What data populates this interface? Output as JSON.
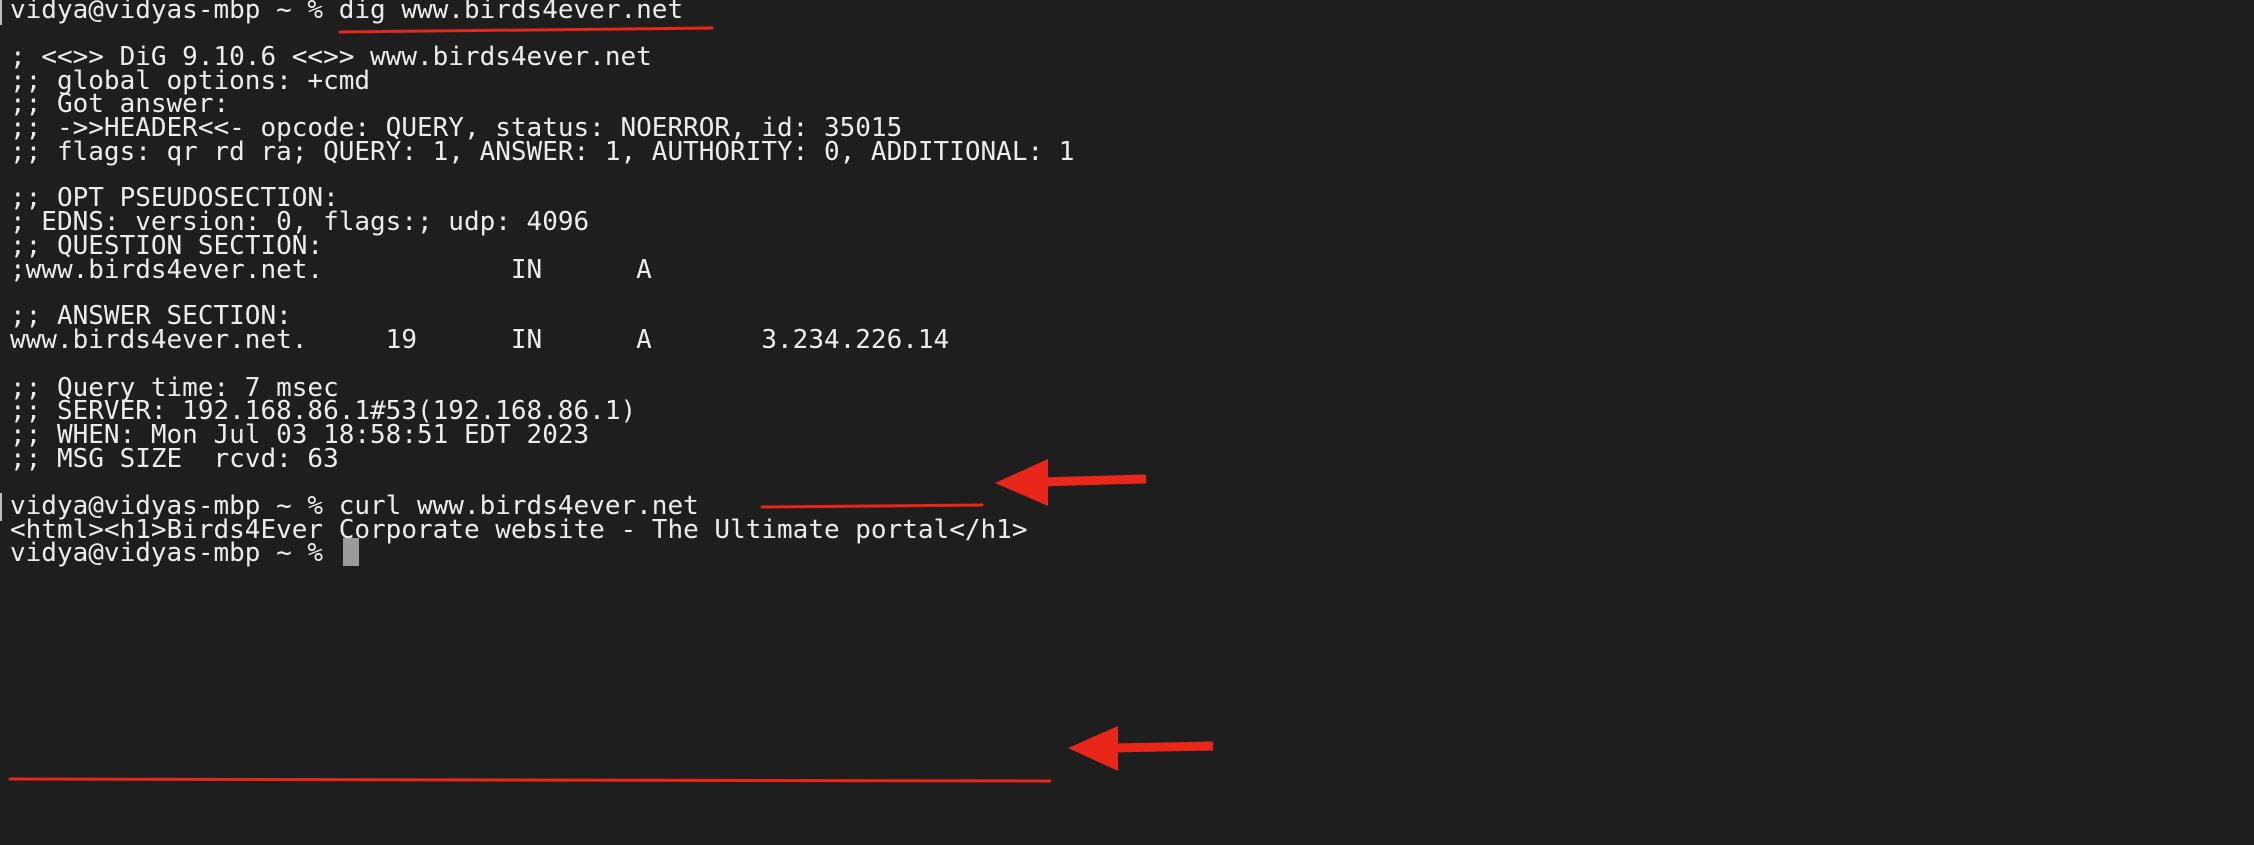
{
  "terminal": {
    "lines": [
      "vidya@vidyas-mbp ~ % dig www.birds4ever.net",
      "",
      "; <<>> DiG 9.10.6 <<>> www.birds4ever.net",
      ";; global options: +cmd",
      ";; Got answer:",
      ";; ->>HEADER<<- opcode: QUERY, status: NOERROR, id: 35015",
      ";; flags: qr rd ra; QUERY: 1, ANSWER: 1, AUTHORITY: 0, ADDITIONAL: 1",
      "",
      ";; OPT PSEUDOSECTION:",
      "; EDNS: version: 0, flags:; udp: 4096",
      ";; QUESTION SECTION:",
      ";www.birds4ever.net.            IN      A",
      "",
      ";; ANSWER SECTION:",
      "www.birds4ever.net.     19      IN      A       3.234.226.14",
      "",
      ";; Query time: 7 msec",
      ";; SERVER: 192.168.86.1#53(192.168.86.1)",
      ";; WHEN: Mon Jul 03 18:58:51 EDT 2023",
      ";; MSG SIZE  rcvd: 63",
      "",
      "vidya@vidyas-mbp ~ % curl www.birds4ever.net",
      "<html><h1>Birds4Ever Corporate website - The Ultimate portal</h1>",
      "vidya@vidyas-mbp ~ % "
    ]
  },
  "colors": {
    "background": "#1e1e1e",
    "text": "#ececec",
    "annotation": "#e8261a",
    "cursor": "#9a9a9a"
  }
}
